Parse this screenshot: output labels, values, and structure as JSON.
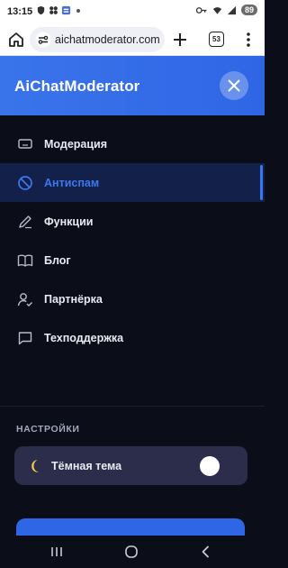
{
  "status_bar": {
    "time": "13:15",
    "battery": "89"
  },
  "browser": {
    "url": "aichatmoderator.com",
    "tab_count": "53"
  },
  "header": {
    "brand": "AiChatModerator"
  },
  "menu": {
    "items": [
      {
        "label": "Модерация",
        "icon": "monitor-icon",
        "active": false
      },
      {
        "label": "Антиспам",
        "icon": "block-icon",
        "active": true
      },
      {
        "label": "Функции",
        "icon": "pencil-icon",
        "active": false
      },
      {
        "label": "Блог",
        "icon": "book-icon",
        "active": false
      },
      {
        "label": "Партнёрка",
        "icon": "user-check-icon",
        "active": false
      },
      {
        "label": "Техподдержка",
        "icon": "chat-bubble-icon",
        "active": false
      }
    ]
  },
  "settings": {
    "title": "НАСТРОЙКИ",
    "theme": {
      "label": "Тёмная тема",
      "enabled": true
    }
  },
  "colors": {
    "accent": "#3b78f0",
    "header": "#3a74ea",
    "bg": "#0b0e19",
    "card": "#2b2d4a"
  }
}
